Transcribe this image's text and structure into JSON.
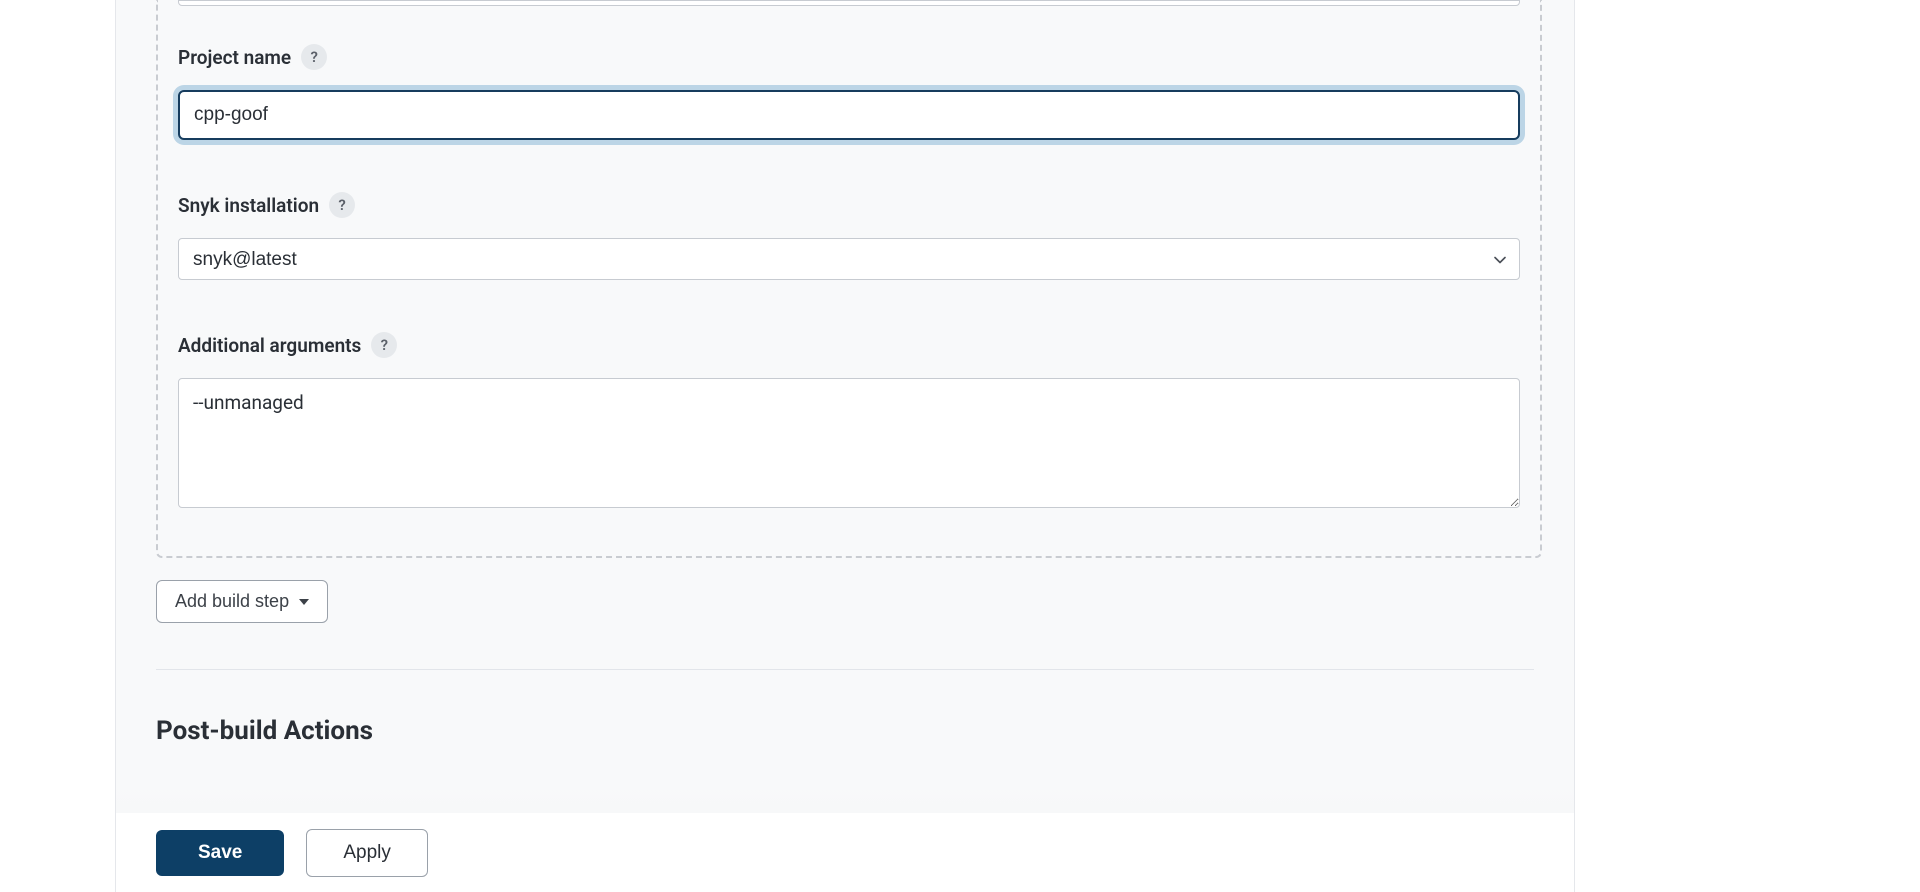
{
  "form": {
    "projectName": {
      "label": "Project name",
      "value": "cpp-goof"
    },
    "snykInstallation": {
      "label": "Snyk installation",
      "value": "snyk@latest"
    },
    "additionalArguments": {
      "label": "Additional arguments",
      "value": "--unmanaged"
    },
    "help": "?"
  },
  "actions": {
    "addBuildStep": "Add build step"
  },
  "sections": {
    "postBuild": "Post-build Actions"
  },
  "footer": {
    "save": "Save",
    "apply": "Apply"
  }
}
